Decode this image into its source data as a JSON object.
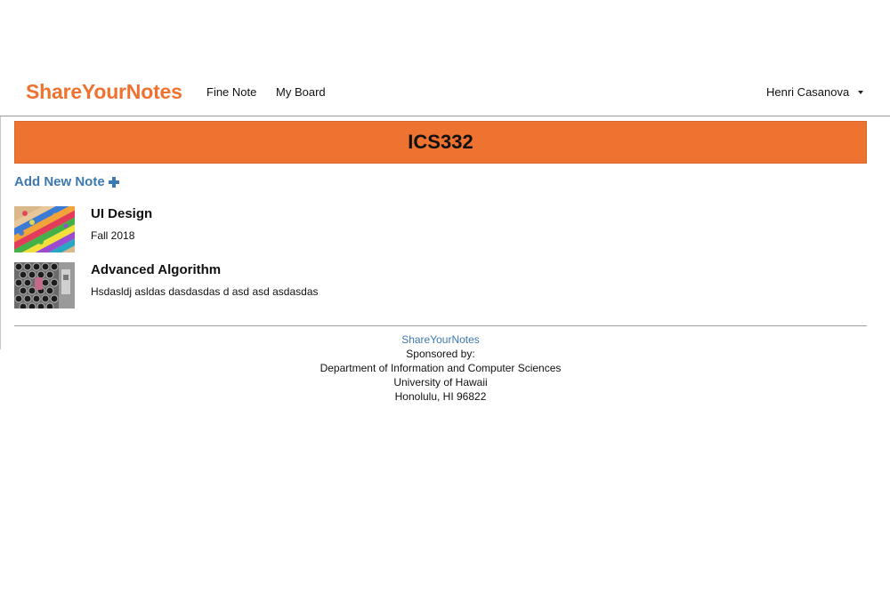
{
  "navbar": {
    "brand": "ShareYourNotes",
    "links": [
      "Fine Note",
      "My Board"
    ],
    "user_name": "Henri Casanova"
  },
  "banner": {
    "title": "ICS332"
  },
  "actions": {
    "add_note_label": "Add New Note"
  },
  "notes": [
    {
      "title": "UI Design",
      "description": "Fall 2018",
      "thumbnail": "colored-pencils-image"
    },
    {
      "title": "Advanced Algorithm",
      "description": "Hsdasldj asldas dasdasdas d asd asd asdasdas",
      "thumbnail": "hexagon-mesh-image"
    }
  ],
  "footer": {
    "link": "ShareYourNotes",
    "sponsored_by": "Sponsored by:",
    "department": "Department of Information and Computer Sciences",
    "university": "University of Hawaii",
    "address": "Honolulu, HI 96822"
  },
  "colors": {
    "brand": "#ee7230",
    "link": "#3c79b0",
    "banner": "#ee7230"
  }
}
